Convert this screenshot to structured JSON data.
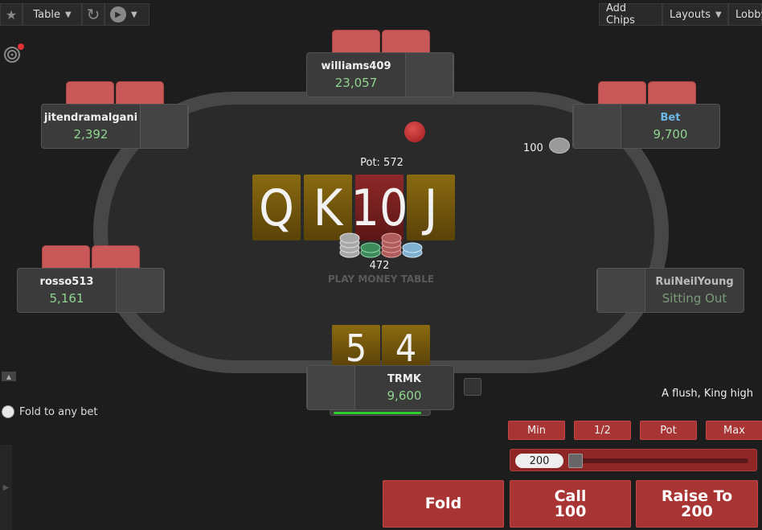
{
  "toolbar": {
    "table_label": "Table",
    "add_chips_label": "Add Chips",
    "layouts_label": "Layouts",
    "lobby_label": "Lobby"
  },
  "seats": {
    "top": {
      "name": "williams409",
      "stack": "23,057"
    },
    "top_left": {
      "name": "jitendramalgani",
      "stack": "2,392"
    },
    "top_right": {
      "name": "Bet",
      "stack": "9,700"
    },
    "left": {
      "name": "rosso513",
      "stack": "5,161"
    },
    "right": {
      "name": "RuiNeilYoung",
      "stack": "Sitting Out"
    },
    "hero": {
      "name": "TRMK",
      "stack": "9,600"
    }
  },
  "bet_amount": "100",
  "pot_label": "Pot: 572",
  "board": [
    "Q",
    "K",
    "10",
    "J"
  ],
  "pot_amount": "472",
  "table_label": "PLAY MONEY TABLE",
  "hero_cards": [
    "5",
    "4"
  ],
  "hand_description": "A flush, King high",
  "fold_to_any_bet": "Fold to any bet",
  "bet_presets": [
    "Min",
    "1/2",
    "Pot",
    "Max"
  ],
  "slider_value": "200",
  "actions": {
    "fold": "Fold",
    "call_label": "Call",
    "call_amount": "100",
    "raise_label": "Raise To",
    "raise_amount": "200"
  },
  "timebank_fraction": 0.92,
  "colors": {
    "action_red": "#a93434",
    "stack_green": "#8fd48f",
    "gold_card": "#8a6a10",
    "red_card": "#8e2828",
    "acting_name": "#6db8e8"
  }
}
